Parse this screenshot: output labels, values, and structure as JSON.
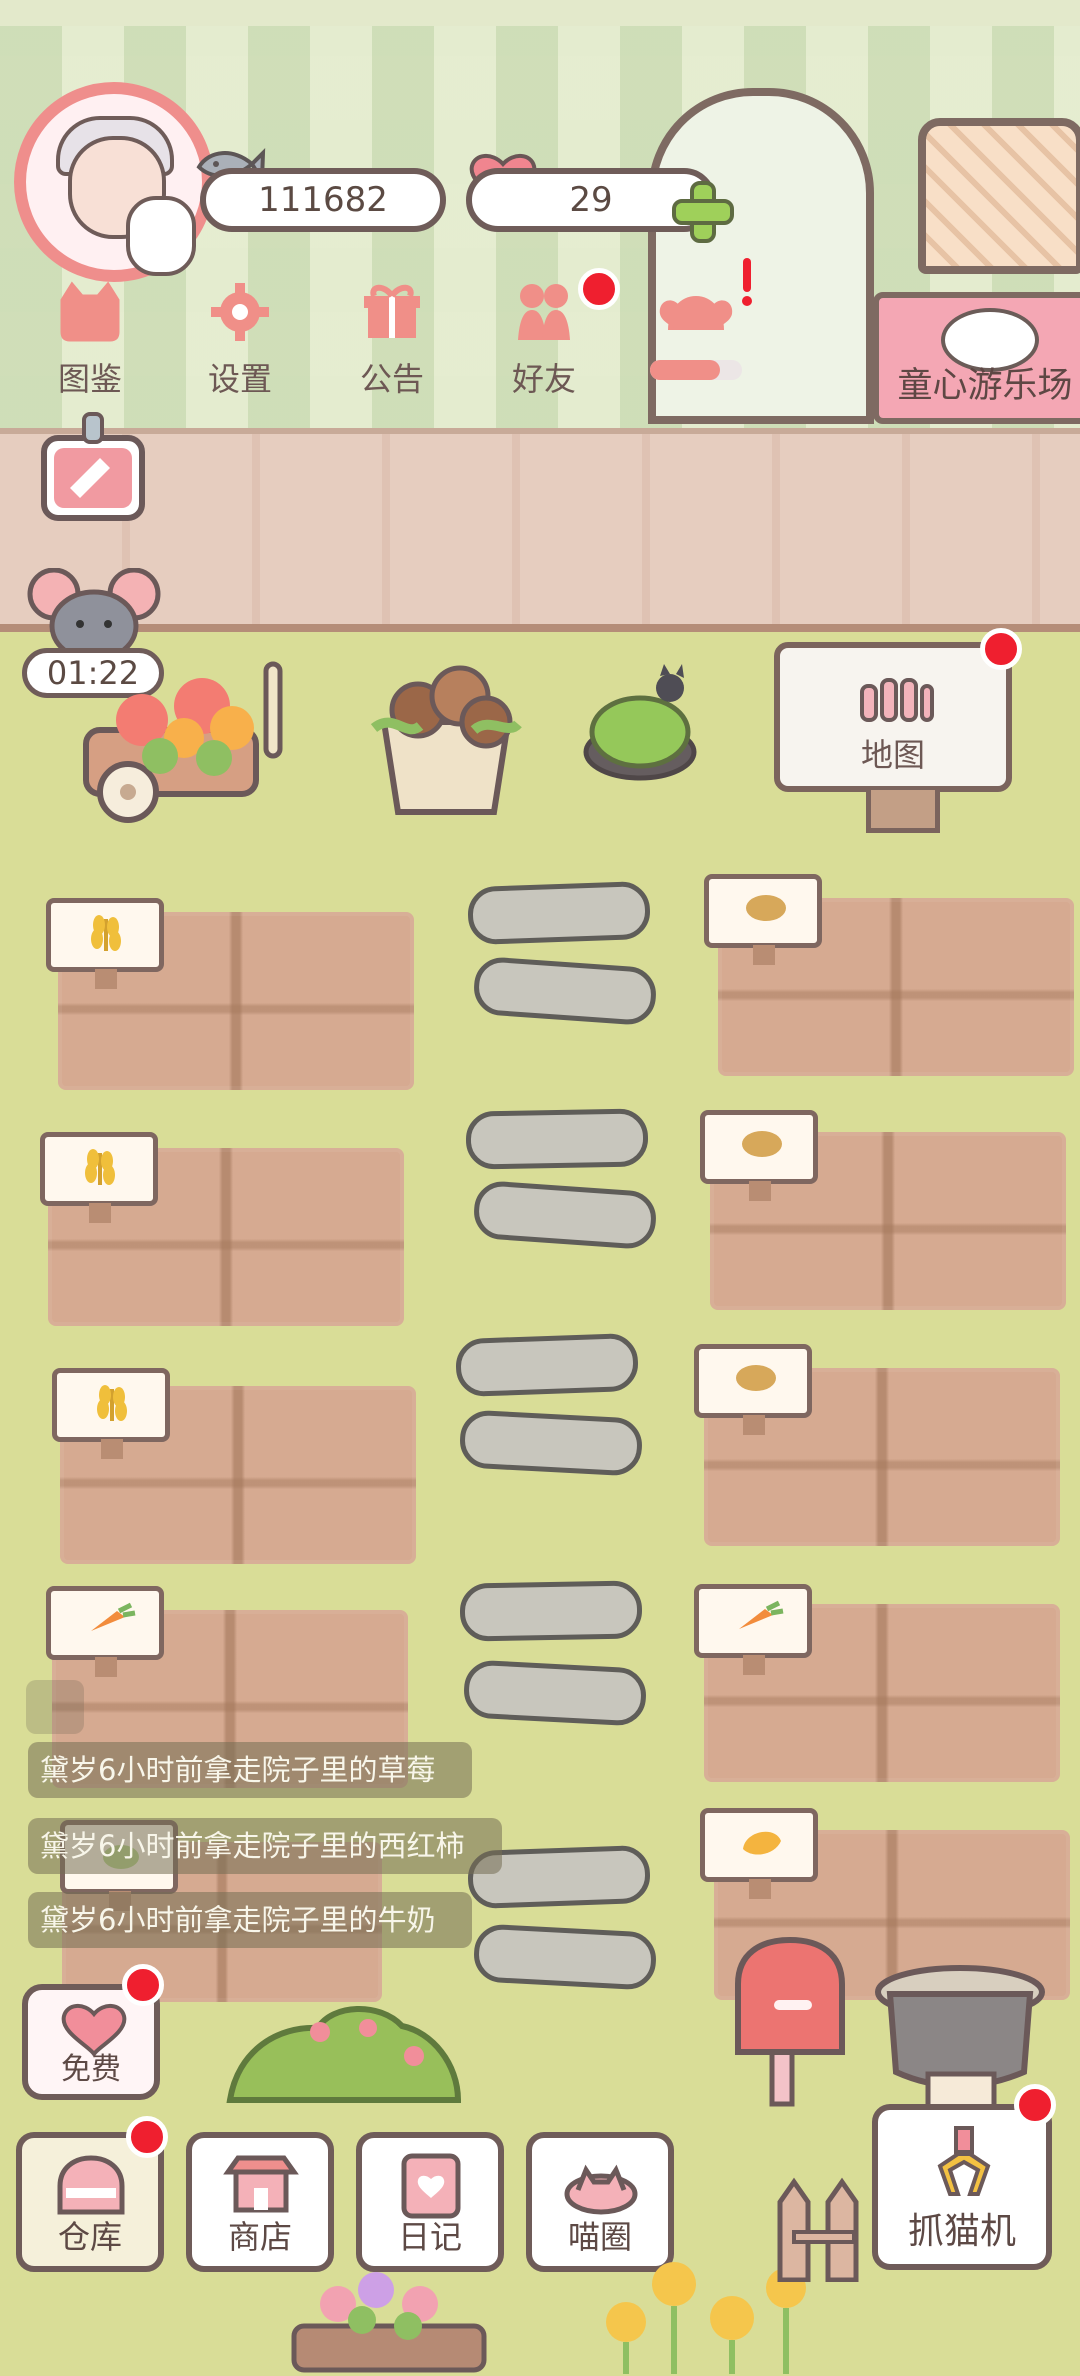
{
  "header": {
    "coins": "111682",
    "hearts": "29",
    "amusement_park": "童心游乐场"
  },
  "menu": {
    "items": [
      {
        "label": "图鉴"
      },
      {
        "label": "设置"
      },
      {
        "label": "公告"
      },
      {
        "label": "好友"
      }
    ]
  },
  "side": {
    "timer": "01:22"
  },
  "map": {
    "label": "地图"
  },
  "feed": {
    "messages": [
      "黛岁6小时前拿走院子里的草莓",
      "黛岁6小时前拿走院子里的西红柿",
      "黛岁6小时前拿走院子里的牛奶"
    ]
  },
  "bottom": {
    "free": "免费",
    "nav": [
      {
        "label": "仓库"
      },
      {
        "label": "商店"
      },
      {
        "label": "日记"
      },
      {
        "label": "喵圈"
      }
    ],
    "claw_machine": "抓猫机"
  },
  "colors": {
    "grass": "#d9dd97",
    "soil": "#d6aa91",
    "outline": "#6f5c59",
    "accent_pink": "#ef8e8c",
    "badge_red": "#ef1f2f"
  },
  "plots": {
    "left": [
      "wheat",
      "wheat",
      "wheat",
      "carrot",
      "mixed"
    ],
    "right": [
      "potato",
      "potato",
      "potato",
      "carrot",
      "mango"
    ]
  }
}
